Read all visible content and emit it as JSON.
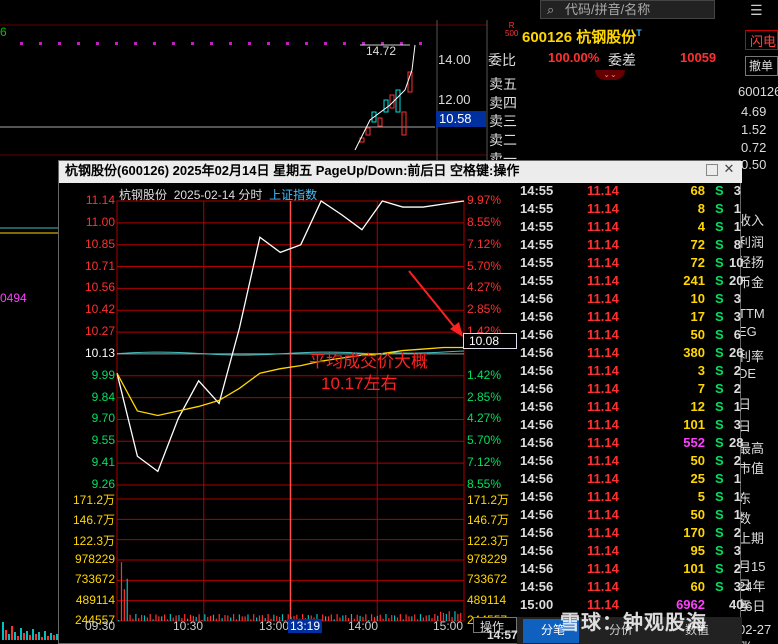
{
  "search": {
    "placeholder": "代码/拼音/名称"
  },
  "quote_panel": {
    "market_mark": "R",
    "market_sub": "500",
    "code": "600126",
    "name": "杭钢股份",
    "suffix": "T",
    "weibi_label": "委比",
    "weibi_value": "100.00%",
    "weicha_label": "委差",
    "weicha_value": "10059",
    "sell_labels": [
      "卖五",
      "卖四",
      "卖三",
      "卖二",
      "卖一"
    ],
    "flash_button": "闪电",
    "cancel_button": "撤单"
  },
  "right_column": {
    "code": "600126",
    "values": [
      "4.69",
      "1.52",
      "0.72",
      "0.50"
    ],
    "labels": [
      "收入",
      "利润",
      "经扬",
      "币金",
      "TTM",
      "EG",
      "利率",
      "DE",
      "日",
      "日",
      "最高",
      "市值",
      "东",
      "数",
      "上期",
      "月15日",
      "24年年",
      "26日",
      "02-27涨"
    ]
  },
  "bg_chart": {
    "price_labels": [
      "14.00",
      "12.00",
      "10.58"
    ],
    "high_label": "14.72",
    "left_value": "0494"
  },
  "popup": {
    "title": "杭钢股份(600126) 2025年02月14日 星期五 PageUp/Down:前后日 空格键:操作",
    "sub_name": "杭钢股份",
    "sub_date": "2025-02-14 分时",
    "sub_index": "上证指数",
    "price_ticks": [
      "11.14",
      "11.00",
      "10.85",
      "10.71",
      "10.56",
      "10.42",
      "10.27",
      "10.13",
      "9.99",
      "9.84",
      "9.70",
      "9.55",
      "9.41",
      "9.26"
    ],
    "pct_ticks": [
      "9.97%",
      "8.55%",
      "7.12%",
      "5.70%",
      "4.27%",
      "2.85%",
      "1.42%",
      "",
      "1.42%",
      "2.85%",
      "4.27%",
      "5.70%",
      "7.12%",
      "8.55%"
    ],
    "vol_ticks": [
      "171.2万",
      "146.7万",
      "122.3万",
      "978229",
      "733672",
      "489114",
      "244557"
    ],
    "time_ticks": [
      "09:30",
      "10:30",
      "13:00",
      "13:19",
      "14:00",
      "15:00"
    ],
    "current_price": "10.08",
    "annotation": [
      "平均成交价大概",
      "10.17左右"
    ],
    "operate_label": "操作",
    "tabs": [
      "分笔",
      "分价",
      "数值"
    ]
  },
  "ticks": [
    {
      "time": "14:55",
      "price": "11.14",
      "vol": "68",
      "side": "S",
      "n": "3"
    },
    {
      "time": "14:55",
      "price": "11.14",
      "vol": "8",
      "side": "S",
      "n": "1"
    },
    {
      "time": "14:55",
      "price": "11.14",
      "vol": "4",
      "side": "S",
      "n": "1"
    },
    {
      "time": "14:55",
      "price": "11.14",
      "vol": "72",
      "side": "S",
      "n": "8"
    },
    {
      "time": "14:55",
      "price": "11.14",
      "vol": "72",
      "side": "S",
      "n": "10"
    },
    {
      "time": "14:55",
      "price": "11.14",
      "vol": "241",
      "side": "S",
      "n": "20"
    },
    {
      "time": "14:56",
      "price": "11.14",
      "vol": "10",
      "side": "S",
      "n": "3"
    },
    {
      "time": "14:56",
      "price": "11.14",
      "vol": "17",
      "side": "S",
      "n": "3"
    },
    {
      "time": "14:56",
      "price": "11.14",
      "vol": "50",
      "side": "S",
      "n": "6"
    },
    {
      "time": "14:56",
      "price": "11.14",
      "vol": "380",
      "side": "S",
      "n": "26"
    },
    {
      "time": "14:56",
      "price": "11.14",
      "vol": "3",
      "side": "S",
      "n": "2"
    },
    {
      "time": "14:56",
      "price": "11.14",
      "vol": "7",
      "side": "S",
      "n": "2"
    },
    {
      "time": "14:56",
      "price": "11.14",
      "vol": "12",
      "side": "S",
      "n": "1"
    },
    {
      "time": "14:56",
      "price": "11.14",
      "vol": "101",
      "side": "S",
      "n": "3"
    },
    {
      "time": "14:56",
      "price": "11.14",
      "vol": "552",
      "side": "S",
      "n": "28"
    },
    {
      "time": "14:56",
      "price": "11.14",
      "vol": "50",
      "side": "S",
      "n": "2"
    },
    {
      "time": "14:56",
      "price": "11.14",
      "vol": "25",
      "side": "S",
      "n": "1"
    },
    {
      "time": "14:56",
      "price": "11.14",
      "vol": "5",
      "side": "S",
      "n": "1"
    },
    {
      "time": "14:56",
      "price": "11.14",
      "vol": "50",
      "side": "S",
      "n": "1"
    },
    {
      "time": "14:56",
      "price": "11.14",
      "vol": "170",
      "side": "S",
      "n": "2"
    },
    {
      "time": "14:56",
      "price": "11.14",
      "vol": "95",
      "side": "S",
      "n": "3"
    },
    {
      "time": "14:56",
      "price": "11.14",
      "vol": "101",
      "side": "S",
      "n": "2"
    },
    {
      "time": "14:56",
      "price": "11.14",
      "vol": "60",
      "side": "S",
      "n": "3"
    },
    {
      "time": "15:00",
      "price": "11.14",
      "vol": "6962",
      "side": "",
      "n": "40"
    }
  ],
  "bottom_left_time": "14:57",
  "watermark": "雪球：钟观股海",
  "colors": {
    "up": "#ff3030",
    "down": "#00e060",
    "price_line": "#ffffff",
    "avg_line": "#ffd700",
    "index_line": "#40c0c0",
    "grid": "#b00000",
    "accent": "#ffd700"
  },
  "chart_data": {
    "type": "line",
    "title": "杭钢股份 2025-02-14 分时",
    "series": [
      {
        "name": "",
        "x": [
          "09:30",
          "09:45",
          "10:00",
          "10:15",
          "10:30",
          "10:45",
          "11:00",
          "11:15",
          "11:30",
          "13:00",
          "13:15",
          "13:30",
          "13:45",
          "14:00",
          "14:15",
          "14:30",
          "14:45",
          "15:00"
        ],
        "values": [
          10.0,
          9.45,
          9.35,
          9.7,
          9.95,
          9.8,
          10.3,
          10.9,
          10.8,
          10.85,
          11.14,
          11.05,
          10.95,
          11.14,
          11.1,
          11.1,
          11.12,
          11.14
        ]
      },
      {
        "name": "",
        "x": [
          "09:30",
          "09:45",
          "10:00",
          "10:15",
          "10:30",
          "10:45",
          "11:00",
          "11:15",
          "11:30",
          "13:00",
          "13:15",
          "13:30",
          "13:45",
          "14:00",
          "14:15",
          "14:30",
          "14:45",
          "15:00"
        ],
        "values": [
          10.0,
          9.75,
          9.72,
          9.75,
          9.78,
          9.82,
          9.9,
          10.0,
          10.03,
          10.05,
          10.08,
          10.1,
          10.12,
          10.13,
          10.15,
          10.16,
          10.17,
          10.17
        ]
      }
    ],
    "ylim": [
      9.26,
      11.14
    ]
  }
}
